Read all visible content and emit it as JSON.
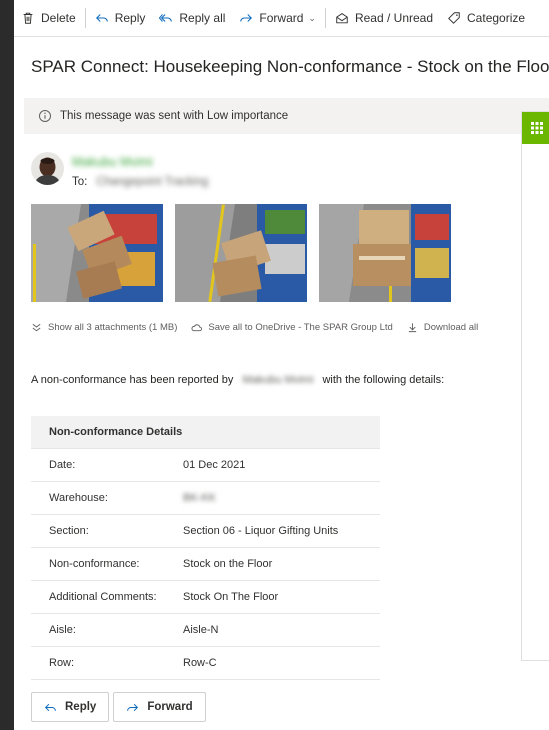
{
  "toolbar": {
    "delete": "Delete",
    "reply": "Reply",
    "reply_all": "Reply all",
    "forward": "Forward",
    "read_unread": "Read / Unread",
    "categorize": "Categorize"
  },
  "message": {
    "subject": "SPAR Connect: Housekeeping Non-conformance - Stock on the Floor",
    "importance_notice": "This message was sent with Low importance",
    "sender_name": "Makubu Mvimi",
    "to_label": "To:",
    "to_value": "Changepoint Tracking"
  },
  "attachments": {
    "show_all": "Show all 3 attachments (1 MB)",
    "save_onedrive": "Save all to OneDrive - The SPAR Group Ltd",
    "download_all": "Download all"
  },
  "body": {
    "intro_prefix": "A non-conformance has been reported by",
    "reporter": "Makubu Mvimi",
    "intro_suffix": "with the following details:"
  },
  "details": {
    "header": "Non-conformance Details",
    "rows": [
      {
        "key": "Date:",
        "value": "01 Dec 2021"
      },
      {
        "key": "Warehouse:",
        "value": "BK-KK"
      },
      {
        "key": "Section:",
        "value": "Section 06 - Liquor Gifting Units"
      },
      {
        "key": "Non-conformance:",
        "value": "Stock on the Floor"
      },
      {
        "key": "Additional Comments:",
        "value": "Stock On The Floor"
      },
      {
        "key": "Aisle:",
        "value": "Aisle-N"
      },
      {
        "key": "Row:",
        "value": "Row-C"
      }
    ]
  },
  "actions": {
    "reply": "Reply",
    "forward": "Forward"
  },
  "colors": {
    "accent_green": "#6bb700",
    "link_blue": "#0f6cbd"
  }
}
